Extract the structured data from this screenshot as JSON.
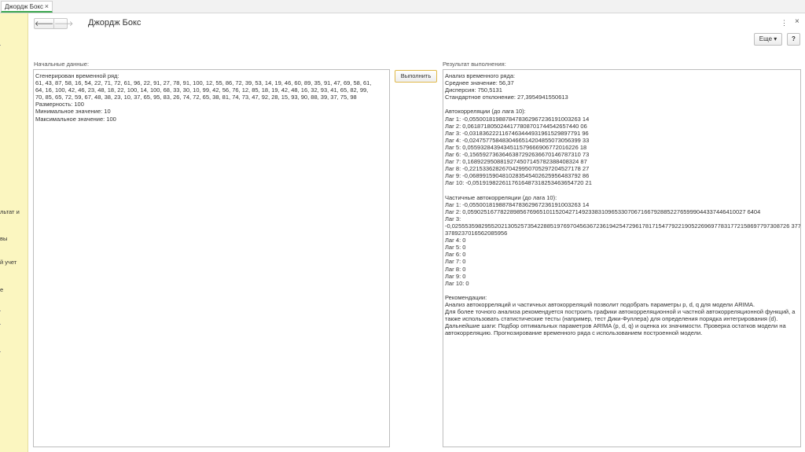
{
  "tabs": [
    {
      "label": "Джордж Бокс",
      "close": "×"
    }
  ],
  "left_panel": {
    "items": [
      "льтат и",
      "вы",
      "й учет",
      "е"
    ]
  },
  "header": {
    "back": "🡐",
    "forward": "🡒",
    "title": "Джордж Бокс",
    "kebab": "⋮",
    "close": "×"
  },
  "toolbar": {
    "more_label": "Еще ▾",
    "help_label": "?"
  },
  "input": {
    "label": "Начальные данные:",
    "lines": [
      "Сгенерирован временной ряд:",
      "61, 43, 87, 58, 16, 54, 22, 71, 72, 61, 96, 22, 91, 27, 78, 91, 100, 12, 55, 86, 72, 39, 53, 14, 19, 46, 60, 89, 35, 91, 47, 69, 58, 61,",
      "64, 16, 100, 42, 46, 23, 48, 18, 22, 100, 14, 100, 68, 33, 30, 10, 99, 42, 56, 76, 12, 85, 18, 19, 42, 48, 16, 32, 93, 41, 65, 82, 99,",
      "70, 85, 65, 72, 59, 67, 48, 38, 23, 10, 37, 65, 95, 83, 26, 74, 72, 65, 38, 81, 74, 73, 47, 92, 28, 15, 93, 90, 88, 39, 37, 75, 98",
      "Размерность: 100",
      "Минимальное значение: 10",
      "Максимальное значение: 100"
    ]
  },
  "run_button": "Выполнить",
  "result": {
    "label": "Результат выполнения:",
    "lines": [
      "Анализ временного ряда:",
      "Среднее значение: 56,37",
      "Дисперсия: 750,5131",
      "Стандартное отклонение: 27,3954941550613",
      "",
      "Автокорреляции (до лага 10):",
      "Лаг 1: -0,0550018198878478362967236191003263 14",
      "Лаг 2: 0,0618718050244177808701744542657440 06",
      "Лаг 3: -0,0318362221167463444931961529897791 96",
      "Лаг 4: -0,0247577584830466514204855073056399 33",
      "Лаг 5: 0,0559328439434511579666906772016226 18",
      "Лаг 6: -0,1565927363646387292636670146787310 73",
      "Лаг 7: 0,1689229508819274507145782388408324 87",
      "Лаг 8: -0,2215336282670429950705297204527178 27",
      "Лаг 9: -0,0689915904810283545402625956483792 86",
      "Лаг 10: -0,0519198226117616487318253463654720 21",
      "",
      "Частичные автокорреляции (до лага 10):",
      "Лаг 1: -0,0550018198878478362967236191003263 14",
      "Лаг 2: 0,0590251677822898567696510115204271492338310965330706716679288522765999044337446410027 6404",
      "Лаг 3:",
      "-0,0255535982955202130525735422885197697045636723619425472961781715477922190522696977831772158697797308726 3773",
      "3789237016562085956",
      "Лаг 4: 0",
      "Лаг 5: 0",
      "Лаг 6: 0",
      "Лаг 7: 0",
      "Лаг 8: 0",
      "Лаг 9: 0",
      "Лаг 10: 0",
      "",
      "Рекомендации:",
      "Анализ автокорреляций и частичных автокорреляций позволит подобрать параметры p, d, q для модели ARIMA.",
      "Для более точного анализа рекомендуется построить графики автокорреляционной и частной автокорреляционной функций, а",
      "также использовать статистические тесты (например, тест Дики-Фуллера) для определения порядка интегрирования (d).",
      "Дальнейшие шаги: Подбор оптимальных параметров ARIMA (p, d, q) и оценка их значимости. Проверка остатков модели на",
      "автокорреляцию. Прогнозирование временного ряда с использованием построенной модели."
    ]
  }
}
